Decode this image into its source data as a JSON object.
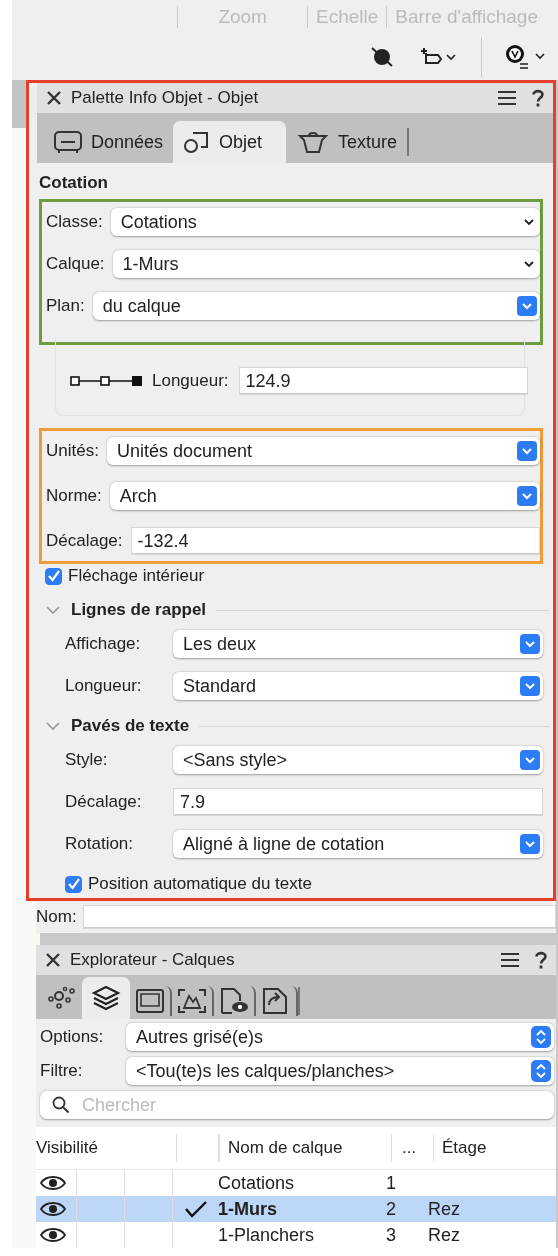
{
  "toolbar": {
    "labels": [
      "Zoom",
      "Echelle",
      "Barre d'affichage"
    ]
  },
  "info_palette": {
    "title": "Palette Info Objet - Objet",
    "tabs": [
      {
        "label": "Données",
        "selected": false
      },
      {
        "label": "Objet",
        "selected": true
      },
      {
        "label": "Texture",
        "selected": false
      }
    ],
    "body": [
      {
        "kind": "heading",
        "text": "Cotation"
      },
      {
        "kind": "group",
        "fields": [
          {
            "label": "Classe:",
            "kind": "select",
            "value": "Cotations"
          },
          {
            "label": "Calque:",
            "kind": "select",
            "value": "1-Murs"
          },
          {
            "label": "Plan:",
            "kind": "popup",
            "value": "du calque"
          }
        ]
      },
      {
        "kind": "length",
        "label": "Longueur:",
        "value": "124.9"
      },
      {
        "kind": "group",
        "fields": [
          {
            "label": "Unités:",
            "kind": "popup",
            "value": "Unités document"
          },
          {
            "label": "Norme:",
            "kind": "popup",
            "value": "Arch"
          },
          {
            "label": "Décalage:",
            "kind": "input",
            "value": "-132.4"
          }
        ]
      },
      {
        "kind": "checkbox",
        "label": "Fléchage intérieur",
        "checked": true
      },
      {
        "kind": "section",
        "title": "Lignes de rappel",
        "expanded": true,
        "fields": [
          {
            "label": "Affichage:",
            "kind": "popup",
            "value": "Les deux"
          },
          {
            "label": "Longueur:",
            "kind": "popup",
            "value": "Standard"
          }
        ]
      },
      {
        "kind": "section",
        "title": "Pavés de texte",
        "expanded": true,
        "fields": [
          {
            "label": "Style:",
            "kind": "popup",
            "value": "<Sans style>"
          },
          {
            "label": "Décalage:",
            "kind": "input",
            "value": "7.9"
          },
          {
            "label": "Rotation:",
            "kind": "popup",
            "value": "Aligné à ligne de cotation"
          }
        ]
      },
      {
        "kind": "checkbox",
        "label": "Position automatique du texte",
        "checked": true
      }
    ],
    "name_field": {
      "label": "Nom:"
    }
  },
  "explorer": {
    "title": "Explorateur - Calques",
    "tabs": [
      {
        "selected": false
      },
      {
        "selected": true
      },
      {
        "selected": false
      },
      {
        "selected": false
      },
      {
        "selected": false
      },
      {
        "selected": false
      }
    ],
    "options": [
      {
        "label": "Options:",
        "value": "Autres grisé(e)s"
      },
      {
        "label": "Filtre:",
        "value": "<Tou(te)s les calques/planches>"
      }
    ],
    "search": {
      "placeholder": "Chercher"
    },
    "table": {
      "columns": [
        "Visibilité",
        "",
        "",
        "Nom de calque",
        "...",
        "Étage"
      ],
      "rows": [
        {
          "visible": true,
          "active": false,
          "name": "Cotations",
          "number": "1",
          "selected": false
        },
        {
          "visible": true,
          "active": true,
          "name": "1-Murs",
          "number": "2",
          "floor": "Rez",
          "selected": true
        },
        {
          "visible": true,
          "active": false,
          "name": "1-Planchers",
          "number": "3",
          "floor": "Rez",
          "selected": false
        }
      ]
    }
  }
}
